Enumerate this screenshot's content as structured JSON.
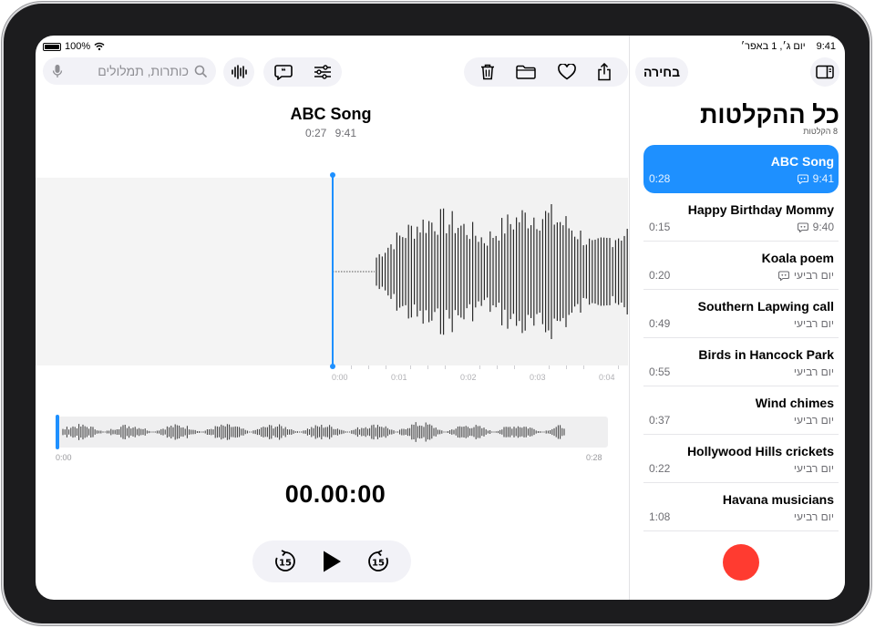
{
  "status_bar": {
    "battery": "100%",
    "time": "9:41",
    "date": "יום ג׳, 1 באפר׳"
  },
  "search": {
    "placeholder": "כותרות, תמלולים"
  },
  "recording": {
    "title": "ABC Song",
    "time": "9:41",
    "duration": "0:27"
  },
  "timeline": {
    "ticks": [
      "0:00",
      "0:01",
      "0:02",
      "0:03",
      "0:04"
    ]
  },
  "overview": {
    "start": "0:00",
    "end": "0:28"
  },
  "playback": {
    "clock": "00.00:00"
  },
  "sidebar": {
    "select_label": "בחירה",
    "title": "כל ההקלטות",
    "count": "8 הקלטות",
    "recordings": [
      {
        "name": "ABC Song",
        "date": "9:41",
        "duration": "0:28",
        "transcript": true,
        "selected": true
      },
      {
        "name": "Happy Birthday Mommy",
        "date": "9:40",
        "duration": "0:15",
        "transcript": true
      },
      {
        "name": "Koala poem",
        "date": "יום רביעי",
        "duration": "0:20",
        "transcript": true
      },
      {
        "name": "Southern Lapwing call",
        "date": "יום רביעי",
        "duration": "0:49",
        "transcript": false
      },
      {
        "name": "Birds in Hancock Park",
        "date": "יום רביעי",
        "duration": "0:55",
        "transcript": false
      },
      {
        "name": "Wind chimes",
        "date": "יום רביעי",
        "duration": "0:37",
        "transcript": false
      },
      {
        "name": "Hollywood Hills crickets",
        "date": "יום רביעי",
        "duration": "0:22",
        "transcript": false
      },
      {
        "name": "Havana musicians",
        "date": "יום רביעי",
        "duration": "1:08",
        "transcript": false
      }
    ]
  },
  "colors": {
    "accent": "#1e90ff",
    "record": "#ff3b30"
  },
  "icons": [
    "microphone-icon",
    "search-icon",
    "waveform-icon",
    "transcript-icon",
    "sliders-icon",
    "trash-icon",
    "folder-icon",
    "heart-icon",
    "share-icon",
    "sidebar-icon",
    "skip-back-15-icon",
    "play-icon",
    "skip-forward-15-icon"
  ]
}
